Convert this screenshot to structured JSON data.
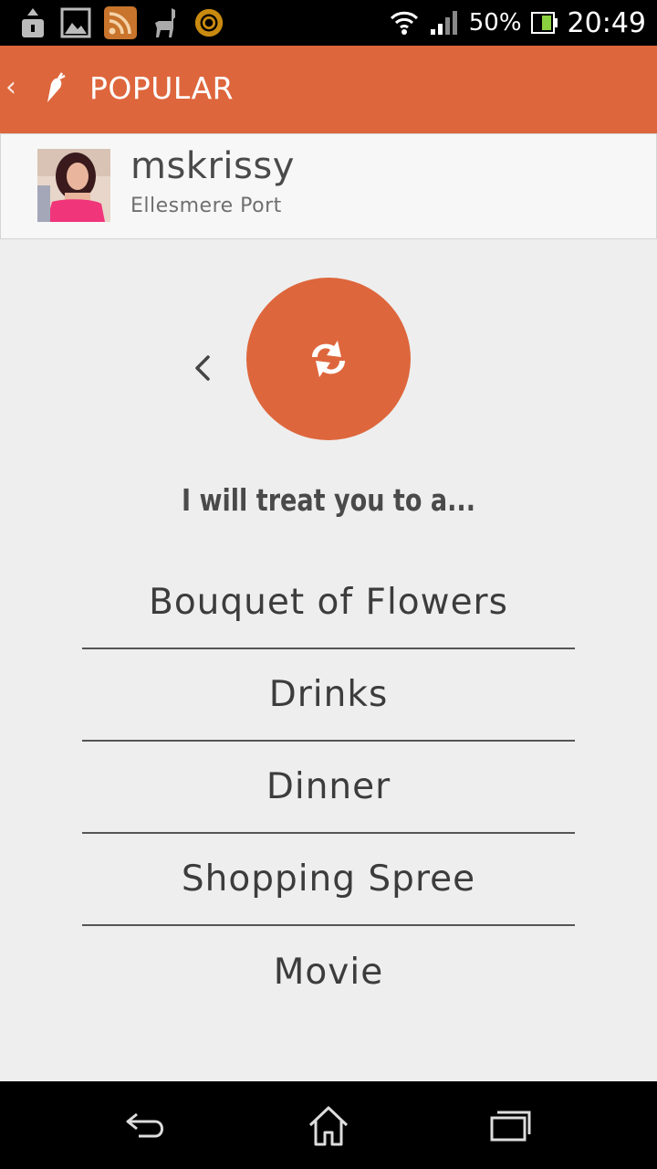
{
  "status_bar": {
    "notification_icons": [
      "upload-icon",
      "image-icon",
      "rss-icon",
      "llama-icon",
      "target-icon"
    ],
    "battery_percent": "50%",
    "time": "20:49",
    "icons": [
      "wifi-icon",
      "signal-icon",
      "battery-icon"
    ]
  },
  "action_bar": {
    "title": "POPULAR",
    "back_icon": "chevron-left-icon",
    "logo_icon": "carrot-icon",
    "color": "#de663c"
  },
  "profile": {
    "username": "mskrissy",
    "location": "Ellesmere Port"
  },
  "treat": {
    "prompt": "I will treat you to a...",
    "refresh_icon": "refresh-icon",
    "options": [
      "Bouquet of Flowers",
      "Drinks",
      "Dinner",
      "Shopping Spree",
      "Movie"
    ]
  },
  "nav_bar": {
    "buttons": [
      "back-icon",
      "home-icon",
      "recent-apps-icon"
    ]
  }
}
